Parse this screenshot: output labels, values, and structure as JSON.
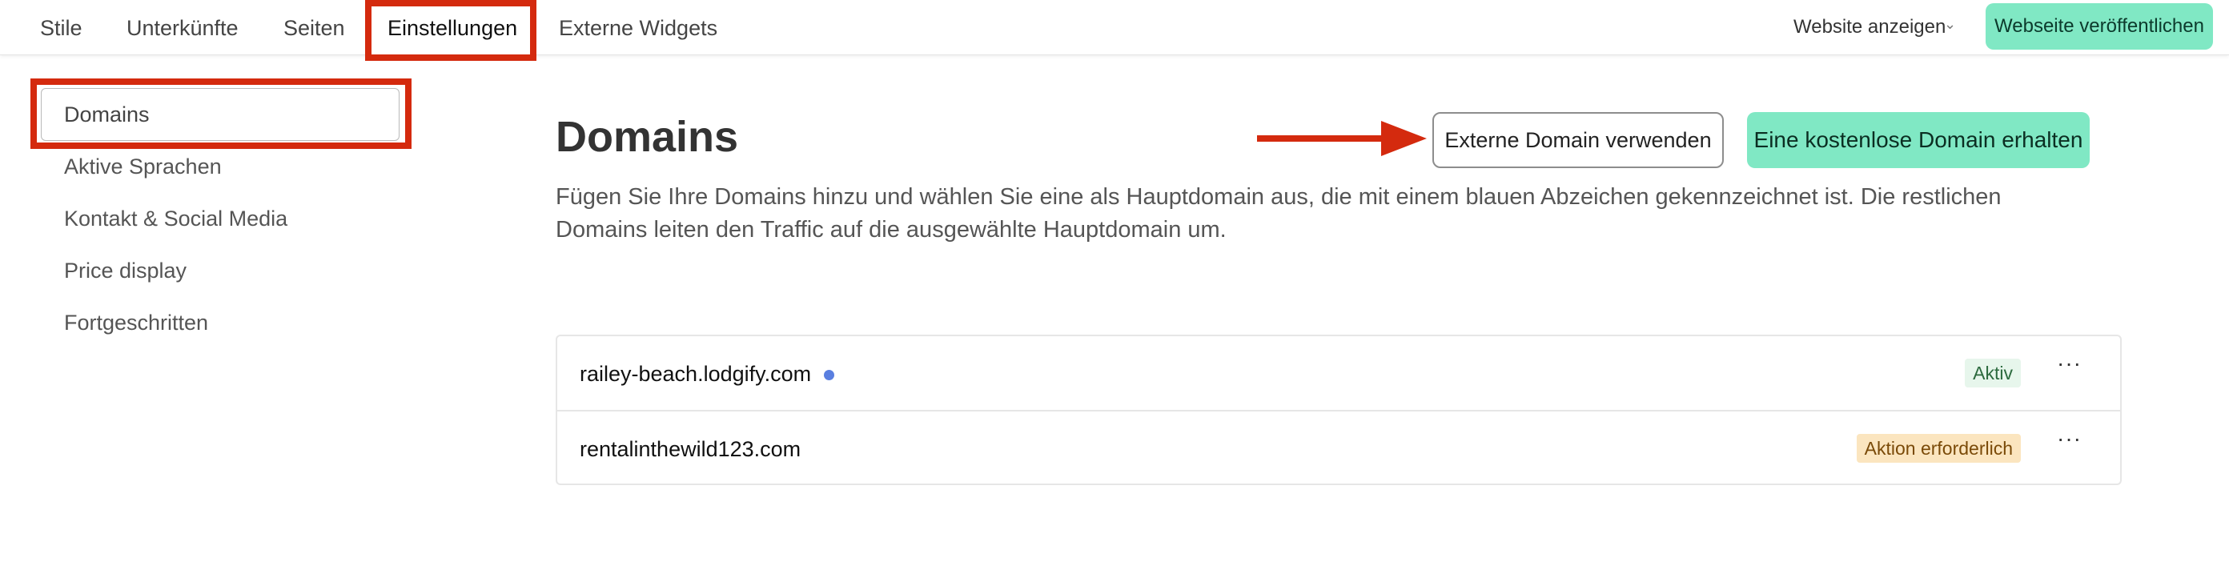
{
  "topnav": {
    "tabs": [
      {
        "label": "Stile"
      },
      {
        "label": "Unterkünfte"
      },
      {
        "label": "Seiten"
      },
      {
        "label": "Einstellungen"
      },
      {
        "label": "Externe Widgets"
      }
    ],
    "view_site": "Website anzeigen",
    "publish": "Webseite veröffentlichen"
  },
  "sidebar": {
    "items": [
      {
        "label": "Domains"
      },
      {
        "label": "Aktive Sprachen"
      },
      {
        "label": "Kontakt & Social Media"
      },
      {
        "label": "Price display"
      },
      {
        "label": "Fortgeschritten"
      }
    ]
  },
  "main": {
    "title": "Domains",
    "description": "Fügen Sie Ihre Domains hinzu und wählen Sie eine als Hauptdomain aus, die mit einem blauen Abzeichen gekennzeichnet ist. Die restlichen Domains leiten den Traffic auf die ausgewählte Hauptdomain um.",
    "external_button": "Externe Domain verwenden",
    "free_button": "Eine kostenlose Domain erhalten",
    "domains": [
      {
        "name": "railey-beach.lodgify.com",
        "status": "Aktiv",
        "menu": "···"
      },
      {
        "name": "rentalinthewild123.com",
        "status": "Aktion erforderlich",
        "menu": "···"
      }
    ]
  },
  "colors": {
    "highlight": "#d42a0e",
    "accent_green": "#80e8c4",
    "primary_dot": "#5a7fe0"
  }
}
